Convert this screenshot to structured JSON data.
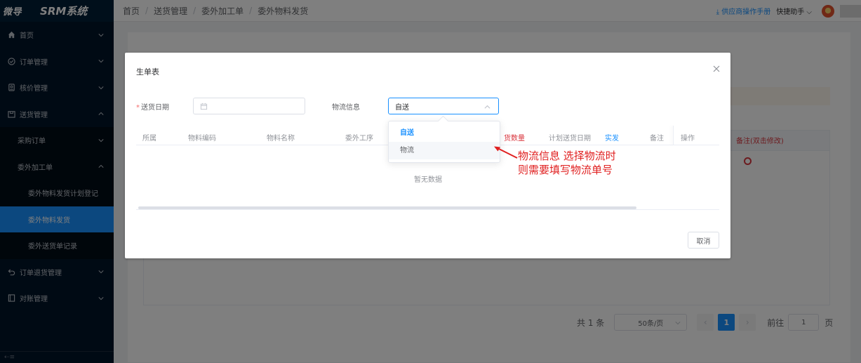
{
  "sidebar": {
    "brand": "微导",
    "system": "SRM系统",
    "items": [
      {
        "label": "首页",
        "icon": "home-icon"
      },
      {
        "label": "订单管理",
        "icon": "check-circle-icon"
      },
      {
        "label": "核价管理",
        "icon": "stamp-icon"
      },
      {
        "label": "送货管理",
        "icon": "delivery-box-icon"
      },
      {
        "label": "订单退货管理",
        "icon": "return-icon"
      },
      {
        "label": "对账管理",
        "icon": "ledger-icon"
      }
    ],
    "sub": {
      "purchase": "采购订单",
      "outsource": "委外加工单",
      "outsource_plan": "委外物料发货计划登记",
      "outsource_ship": "委外物料发货",
      "outsource_record": "委外送货单记录"
    },
    "footer": "⇠≡"
  },
  "header": {
    "breadcrumb": [
      "首页",
      "送货管理",
      "委外加工单",
      "委外物料发货"
    ],
    "manual": "供应商操作手册",
    "assistant": "快捷助手",
    "colors": {
      "accent": "#1890ff"
    }
  },
  "main": {
    "remark_col": "备注(双击修改)",
    "pager": {
      "total": "共 1 条",
      "size": "50条/页",
      "page": "1",
      "goto": "前往",
      "goto_value": "1",
      "page_unit": "页"
    }
  },
  "dialog": {
    "title": "生单表",
    "date_label": "送货日期",
    "logistics_label": "物流信息",
    "logistics_value": "自送",
    "columns": [
      "所属",
      "物料编码",
      "物料名称",
      "委外工序",
      "货数量",
      "计划送货日期",
      "实发",
      "备注",
      "操作"
    ],
    "empty": "暂无数据",
    "cancel": "取消",
    "dropdown": [
      "自送",
      "物流"
    ]
  },
  "annotation": {
    "line1": "物流信息 选择物流时",
    "line2": "则需要填写物流单号",
    "color": "#e02020"
  }
}
